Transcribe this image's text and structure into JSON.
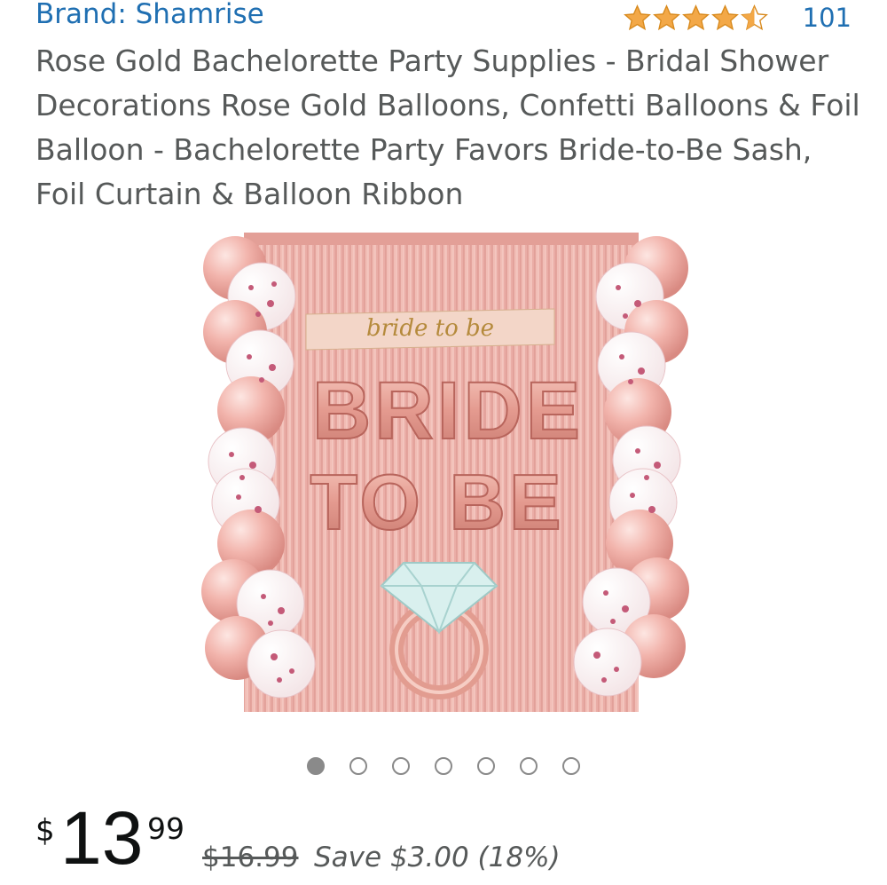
{
  "brand_label": "Brand: Shamrise",
  "rating": {
    "stars": 4.5,
    "count": "101"
  },
  "title": "Rose Gold Bachelorette Party Supplies - Bridal Shower Decorations Rose Gold Balloons, Confetti Balloons & Foil Balloon - Bachelorette Party Favors Bride-to-Be Sash, Foil Curtain & Balloon Ribbon",
  "image": {
    "sash_text": "bride to be",
    "balloon_line1": "BRIDE",
    "balloon_line2": "TO BE"
  },
  "carousel": {
    "total": 7,
    "active": 0
  },
  "price": {
    "currency": "$",
    "whole": "13",
    "fraction": "99",
    "list_price": "$16.99",
    "savings": "Save $3.00 (18%)"
  },
  "colors": {
    "link": "#1f6fb2",
    "star": "#f3a847",
    "rose": "#e8a9a2"
  }
}
